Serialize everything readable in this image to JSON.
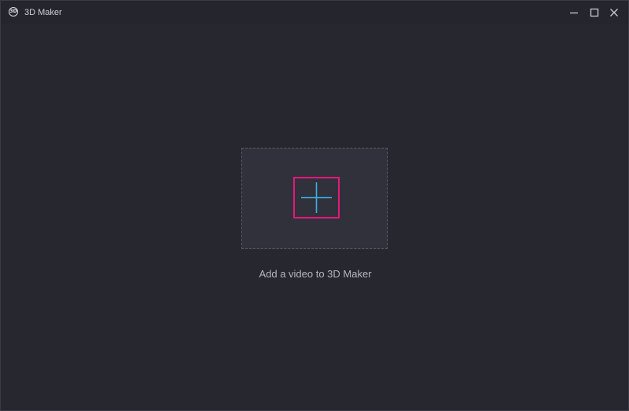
{
  "window": {
    "title": "3D Maker",
    "logo_text": "3D",
    "logo_icon": "3d-maker-logo-icon",
    "controls": [
      "minimize-icon",
      "maximize-icon",
      "close-icon"
    ]
  },
  "main": {
    "dropzone_icon": "plus-icon",
    "hint": "Add a video to 3D Maker"
  },
  "colors": {
    "background": "#26272f",
    "dropzone_bg": "#30313b",
    "dropzone_border": "#5a5b66",
    "highlight": "#e8177d",
    "plus": "#3fb1ea",
    "text": "#b7b8bd"
  }
}
